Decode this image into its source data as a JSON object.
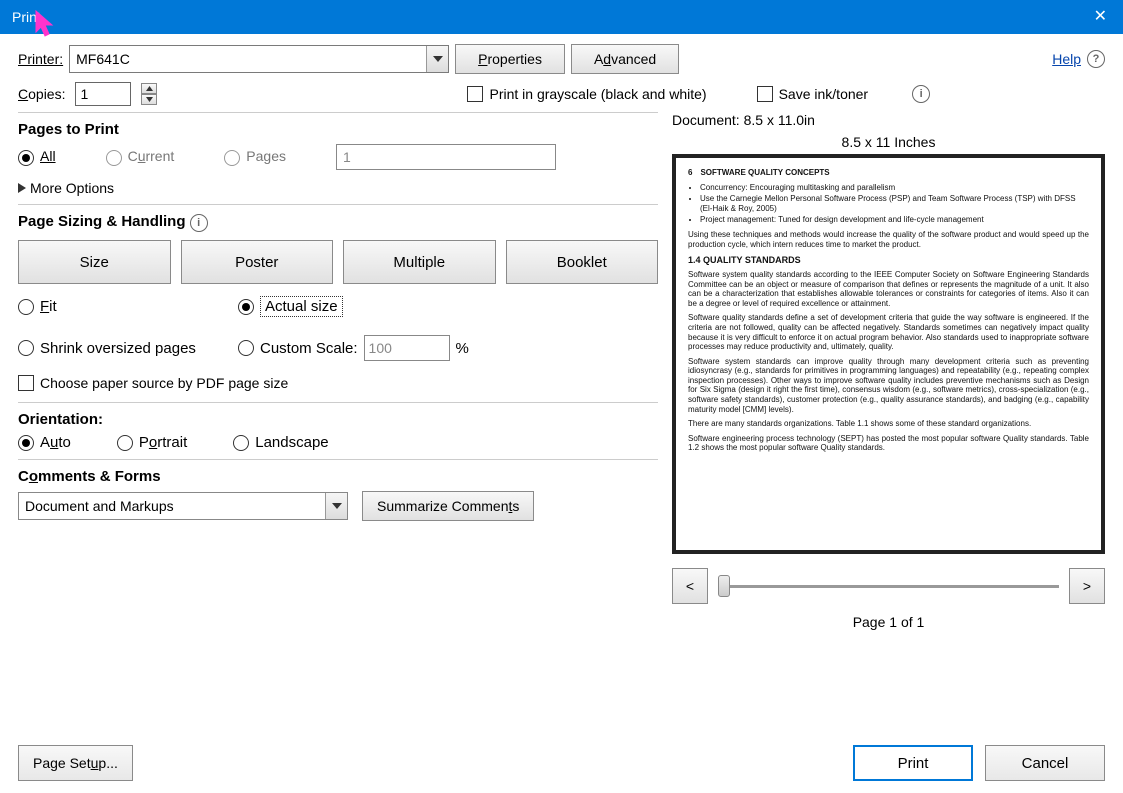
{
  "title": "Print",
  "help_label": "Help",
  "printer": {
    "label": "Printer:",
    "value": "MF641C",
    "properties": "Properties",
    "advanced": "Advanced"
  },
  "copies": {
    "label": "Copies:",
    "value": "1"
  },
  "grayscale_label": "Print in grayscale (black and white)",
  "saveink_label": "Save ink/toner",
  "pages_to_print": {
    "title": "Pages to Print",
    "all": "All",
    "current": "Current",
    "pages": "Pages",
    "pages_value": "1",
    "more": "More Options"
  },
  "sizing": {
    "title": "Page Sizing & Handling",
    "size": "Size",
    "poster": "Poster",
    "multiple": "Multiple",
    "booklet": "Booklet",
    "fit": "Fit",
    "actual": "Actual size",
    "shrink": "Shrink oversized pages",
    "custom": "Custom Scale:",
    "custom_val": "100",
    "percent": "%",
    "papersrc": "Choose paper source by PDF page size"
  },
  "orientation": {
    "title": "Orientation:",
    "auto": "Auto",
    "portrait": "Portrait",
    "landscape": "Landscape"
  },
  "comments": {
    "title": "Comments & Forms",
    "value": "Document and Markups",
    "summarize": "Summarize Comments"
  },
  "preview": {
    "doc_info": "Document: 8.5 x 11.0in",
    "page_size": "8.5 x 11 Inches",
    "pageno": "6",
    "header": "SOFTWARE QUALITY CONCEPTS",
    "bullets": [
      "Concurrency: Encouraging multitasking and parallelism",
      "Use the Carnegie Mellon Personal Software Process (PSP) and Team Software Process (TSP) with DFSS (El-Haik & Roy, 2005)",
      "Project management: Tuned for design development and life-cycle management"
    ],
    "para1": "Using these techniques and methods would increase the quality of the software product and would speed up the production cycle, which intern reduces time to market the product.",
    "sect": "1.4  QUALITY STANDARDS",
    "para2": "Software system quality standards according to the IEEE Computer Society on Software Engineering Standards Committee can be an object or measure of comparison that defines or represents the magnitude of a unit. It also can be a characterization that establishes allowable tolerances or constraints for categories of items. Also it can be a degree or level of required excellence or attainment.",
    "para3": "Software quality standards define a set of development criteria that guide the way software is engineered. If the criteria are not followed, quality can be affected negatively. Standards sometimes can negatively impact quality because it is very difficult to enforce it on actual program behavior. Also standards used to inappropriate software processes may reduce productivity and, ultimately, quality.",
    "para4": "Software system standards can improve quality through many development criteria such as preventing idiosyncrasy (e.g., standards for primitives in programming languages) and repeatability (e.g., repeating complex inspection processes). Other ways to improve software quality includes preventive mechanisms such as Design for Six Sigma (design it right the first time), consensus wisdom (e.g., software metrics), cross-specialization (e.g., software safety standards), customer protection (e.g., quality assurance standards), and badging (e.g., capability maturity model [CMM] levels).",
    "para5": "There are many standards organizations. Table 1.1 shows some of these standard organizations.",
    "para6": "Software engineering process technology (SEPT) has posted the most popular software Quality standards. Table 1.2 shows the most popular software Quality standards.",
    "page_count": "Page 1 of 1"
  },
  "footer": {
    "pagesetup": "Page Setup...",
    "print": "Print",
    "cancel": "Cancel"
  }
}
